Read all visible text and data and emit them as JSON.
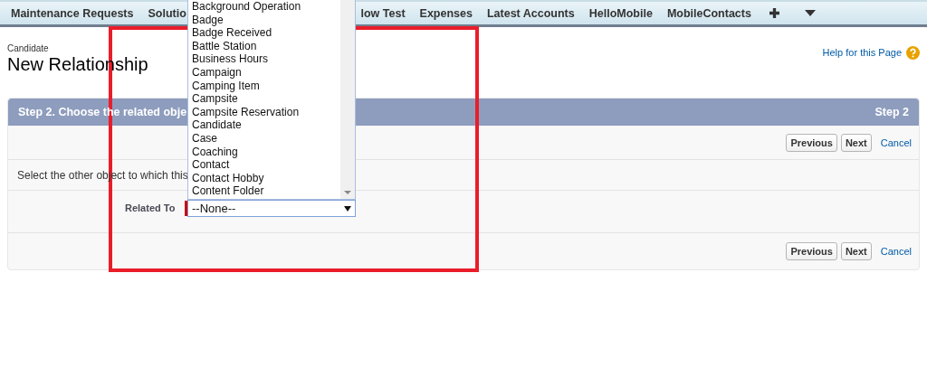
{
  "nav_tabs": [
    {
      "label": "Maintenance Requests"
    },
    {
      "label": "Solutio"
    },
    {
      "label": "low Test"
    },
    {
      "label": "Expenses"
    },
    {
      "label": "Latest Accounts"
    },
    {
      "label": "HelloMobile"
    },
    {
      "label": "MobileContacts"
    }
  ],
  "page": {
    "object_label": "Candidate",
    "title": "New Relationship",
    "help_link": "Help for this Page"
  },
  "wizard": {
    "header_title": "Step 2. Choose the related obje",
    "step_label": "Step 2",
    "top_buttons": [
      "Previous",
      "Next"
    ],
    "top_cancel": "Cancel",
    "instruction": "Select the other object to which this",
    "related_field": {
      "label": "Related To",
      "required": true,
      "value": "--None--",
      "expanded": true,
      "options": [
        "Background Operation",
        "Badge",
        "Badge Received",
        "Battle Station",
        "Business Hours",
        "Campaign",
        "Camping Item",
        "Campsite",
        "Campsite Reservation",
        "Candidate",
        "Case",
        "Coaching",
        "Contact",
        "Contact Hobby",
        "Content Folder"
      ]
    },
    "bottom_buttons": [
      "Previous",
      "Next"
    ],
    "bottom_cancel": "Cancel"
  }
}
